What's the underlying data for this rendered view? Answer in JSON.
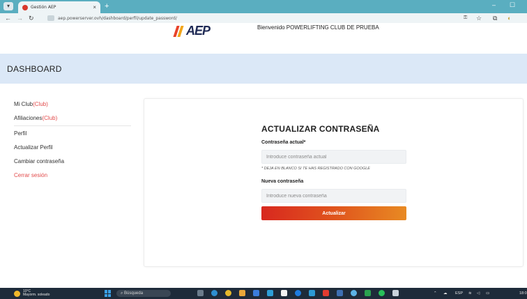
{
  "browser": {
    "tab_title": "Gestión AEP",
    "url": "aep.powerserver.ovh/dashboard/perfil/update_password/",
    "new_tab": "+",
    "tab_close": "×",
    "minimize": "–",
    "restore": "☐"
  },
  "header": {
    "logo_text": "AEP",
    "welcome": "Bienvenido POWERLIFTING CLUB DE PRUEBA"
  },
  "dashboard": {
    "title": "DASHBOARD"
  },
  "sidebar": {
    "items": [
      {
        "label": "Mi Club",
        "tag": "(Club)"
      },
      {
        "label": "Afiliaciones",
        "tag": "(Club)"
      },
      {
        "label": "Perfil"
      },
      {
        "label": "Actualizar Perfil"
      },
      {
        "label": "Cambiar contraseña"
      },
      {
        "label": "Cerrar sesión"
      }
    ]
  },
  "form": {
    "title": "ACTUALIZAR CONTRASEÑA",
    "current_label": "Contraseña actual*",
    "current_placeholder": "Introduce contraseña actual",
    "google_note": "* DEJA EN BLANCO SI TE HAS REGISTRADO CON GOOGLE",
    "new_label": "Nueva contraseña",
    "new_placeholder": "Introduce nueva contraseña",
    "submit": "Actualizar"
  },
  "taskbar": {
    "temperature": "10°C",
    "weather": "Mayorm. soleado",
    "search": "Búsqueda",
    "language": "ESP",
    "time": "18:0"
  },
  "colors": {
    "accent_red": "#e24b4b",
    "button_start": "#d8281f",
    "button_end": "#e88a23",
    "dashboard_band": "#dbe8f7",
    "browser_frame": "#5aaec0"
  }
}
